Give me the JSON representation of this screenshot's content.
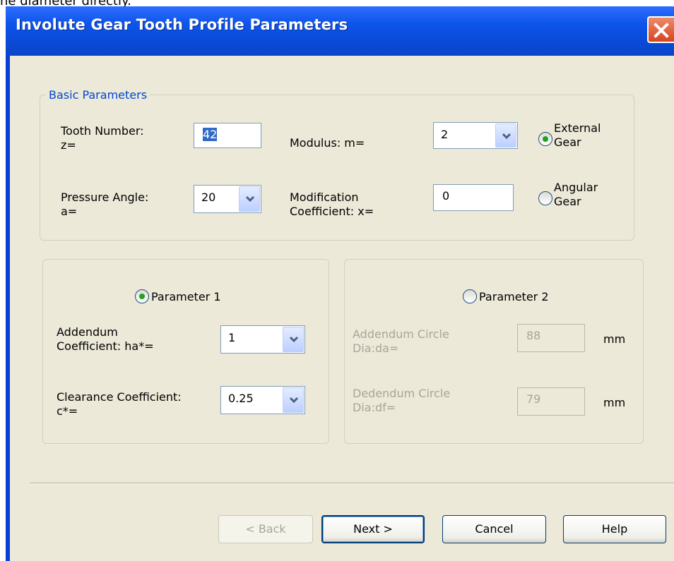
{
  "background_text": "ne diameter directly.",
  "window": {
    "title": "Involute Gear Tooth Profile Parameters"
  },
  "basic": {
    "legend": "Basic Parameters",
    "tooth_number_label_1": "Tooth Number:",
    "tooth_number_label_2": "z=",
    "tooth_number_value": "42",
    "modulus_label": "Modulus: m=",
    "modulus_value": "2",
    "pressure_angle_label_1": "Pressure Angle:",
    "pressure_angle_label_2": "a=",
    "pressure_angle_value": "20",
    "modification_label_1": "Modification",
    "modification_label_2": "Coefficient: x=",
    "modification_value": "0",
    "external_gear_1": "External",
    "external_gear_2": "Gear",
    "angular_gear_1": "Angular",
    "angular_gear_2": "Gear"
  },
  "param1": {
    "radio_label": "Parameter 1",
    "addendum_label_1": "Addendum",
    "addendum_label_2": "Coefficient: ha*=",
    "addendum_value": "1",
    "clearance_label_1": "Clearance Coefficient:",
    "clearance_label_2": "c*=",
    "clearance_value": "0.25"
  },
  "param2": {
    "radio_label": "Parameter 2",
    "addendum_dia_label_1": "Addendum Circle",
    "addendum_dia_label_2": "Dia:da=",
    "addendum_dia_value": "88",
    "addendum_unit": "mm",
    "dedendum_dia_label_1": "Dedendum Circle",
    "dedendum_dia_label_2": "Dia:df=",
    "dedendum_dia_value": "79",
    "dedendum_unit": "mm"
  },
  "buttons": {
    "back": "< Back",
    "next": "Next >",
    "cancel": "Cancel",
    "help": "Help"
  },
  "colors": {
    "titlebar": "#0a4ad8",
    "client": "#ece9d8",
    "legend_text": "#0046d5",
    "radio_dot": "#21a121"
  },
  "icons": {
    "close": "close-x-icon",
    "dropdown": "chevron-down-icon"
  }
}
